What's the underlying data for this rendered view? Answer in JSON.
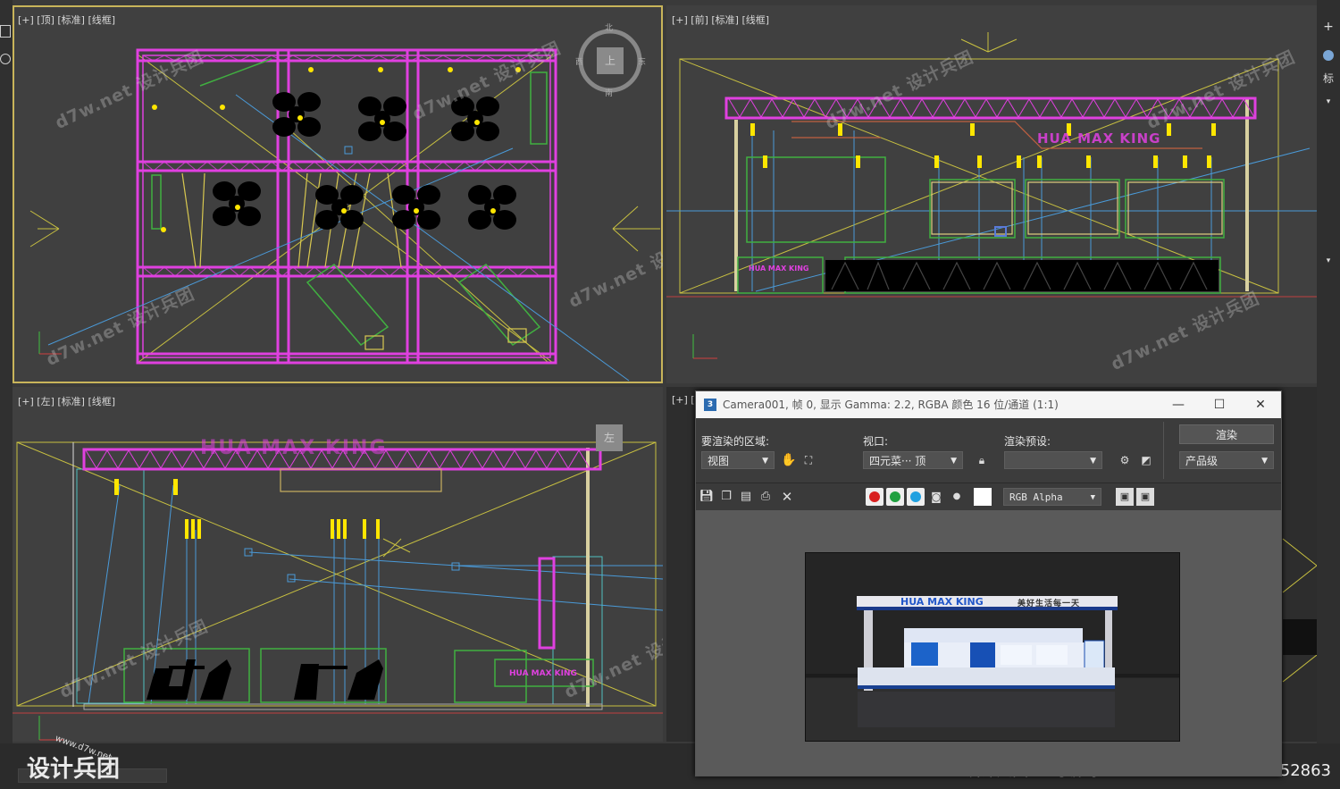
{
  "viewports": {
    "top": {
      "label": "[+] [顶] [标准] [线框]",
      "nav_north": "北",
      "nav_south": "南",
      "nav_west": "西",
      "nav_east": "东",
      "nav_cube": "上"
    },
    "front": {
      "label": "[+] [前] [标准] [线框]",
      "sign": "HUA MAX KING",
      "small_sign": "HUA MAX KING"
    },
    "left": {
      "label": "[+] [左] [标准] [线框]",
      "nav_cube": "左",
      "sign": "HUA MAX KING"
    },
    "persp": {
      "label": "[+] ["
    }
  },
  "watermark": "d7w.net 设计兵团",
  "render_window": {
    "title": "Camera001, 帧 0, 显示 Gamma: 2.2, RGBA 颜色 16 位/通道 (1:1)",
    "area_label": "要渲染的区域:",
    "area_value": "视图",
    "viewport_label": "视口:",
    "viewport_value": "四元菜··· 顶",
    "preset_label": "渲染预设:",
    "preset_value": "",
    "render_button": "渲染",
    "quality_value": "产品级",
    "channel_value": "RGB Alpha",
    "render_sign": "HUA MAX KING",
    "render_slogan": "美好生活每一天"
  },
  "right_panel": {
    "plus": "+",
    "tab": "标"
  },
  "footer": {
    "brand": "设计兵团",
    "brand_url": "www.d7w.net",
    "text": "设计兵团  查询编码：d7w.net20240705d652863"
  }
}
